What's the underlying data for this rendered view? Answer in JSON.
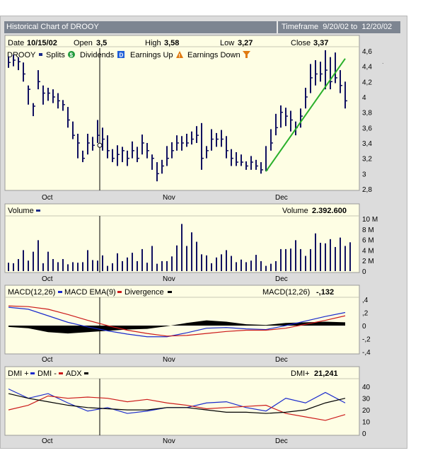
{
  "window": {
    "title": "Historical Chart of DROOY",
    "timeframe_label": "Timeframe",
    "timeframe_from": "9/20/02",
    "timeframe_to_word": "to",
    "timeframe_to": "12/20/02"
  },
  "price_panel": {
    "date_label": "Date",
    "date_value": "10/15/02",
    "open_label": "Open",
    "open_value": "3,5",
    "high_label": "High",
    "high_value": "3,58",
    "low_label": "Low",
    "low_value": "3,27",
    "close_label": "Close",
    "close_value": "3,37",
    "symbol": "DROOY",
    "legend": [
      {
        "label": "Splits",
        "icon": "square-marker-icon",
        "icon_char": "",
        "color": "#1a2a8a"
      },
      {
        "label": "Dividends",
        "icon": "dollar-icon",
        "icon_char": "$",
        "color": "#1f9a3a"
      },
      {
        "label": "Earnings Up",
        "icon": "d-box-icon",
        "icon_char": "D",
        "color": "#1f5fd8"
      },
      {
        "label": "Earnings Down",
        "icon": "warning-triangle-icon",
        "icon_char": "!",
        "color": "#e07a10"
      }
    ],
    "earnings_down_icon": "funnel-icon",
    "y_ticks": [
      "4,6",
      "4,4",
      "4,2",
      "4",
      "3,8",
      "3,6",
      "3,4",
      "3,2",
      "3",
      "2,8"
    ]
  },
  "volume_panel": {
    "title": "Volume",
    "value_label": "Volume",
    "value": "2.392.600",
    "y_ticks": [
      "10 M",
      "8 M",
      "6 M",
      "4 M",
      "2 M",
      "0"
    ]
  },
  "macd_panel": {
    "legend": [
      {
        "label": "MACD(12,26)",
        "color": "#1a2acc"
      },
      {
        "label": "MACD EMA(9)",
        "color": "#cc1a1a"
      },
      {
        "label": "Divergence",
        "color": "#000000"
      }
    ],
    "value_label": "MACD(12,26)",
    "value": "-,132",
    "y_ticks": [
      ",4",
      ",2",
      "0",
      "-,2",
      "-,4"
    ]
  },
  "dmi_panel": {
    "legend": [
      {
        "label": "DMI +",
        "color": "#1a2acc"
      },
      {
        "label": "DMI -",
        "color": "#cc1a1a"
      },
      {
        "label": "ADX",
        "color": "#000000"
      }
    ],
    "value_label": "DMI+",
    "value": "21,241",
    "y_ticks": [
      "40",
      "30",
      "20",
      "10",
      "0"
    ]
  },
  "x_ticks": [
    "Oct",
    "Nov",
    "Dec"
  ],
  "colors": {
    "panel_bg": "#fefee4",
    "bar": "#101060",
    "trendline": "#2ab02a",
    "frame": "#dcdcdc",
    "title_bg": "#7d8591"
  },
  "chart_data": [
    {
      "type": "ohlc",
      "title": "DROOY",
      "x_labels": [
        "Oct",
        "Nov",
        "Dec"
      ],
      "ylim": [
        2.8,
        4.6
      ],
      "high": [
        4.53,
        4.55,
        4.52,
        4.45,
        4.15,
        3.92,
        4.35,
        4.15,
        4.12,
        4.1,
        4.05,
        3.96,
        3.87,
        3.68,
        3.52,
        3.3,
        3.52,
        3.48,
        3.7,
        3.6,
        3.5,
        3.32,
        3.37,
        3.35,
        3.3,
        3.42,
        3.35,
        3.51,
        3.4,
        3.25,
        3.15,
        3.18,
        3.36,
        3.41,
        3.5,
        3.49,
        3.52,
        3.55,
        3.62,
        3.66,
        3.36,
        3.58,
        3.53,
        3.57,
        3.49,
        3.32,
        3.28,
        3.25,
        3.16,
        3.23,
        3.18,
        3.15,
        3.36,
        3.58,
        3.78,
        3.89,
        3.86,
        3.82,
        3.68,
        3.85,
        4.12,
        4.43,
        4.48,
        4.46,
        4.61,
        4.52,
        4.58,
        4.35,
        4.2
      ],
      "low": [
        4.38,
        4.4,
        4.35,
        4.2,
        3.9,
        3.75,
        4.1,
        3.9,
        3.95,
        3.92,
        3.85,
        3.82,
        3.6,
        3.45,
        3.2,
        3.15,
        3.25,
        3.3,
        3.4,
        3.3,
        3.2,
        3.15,
        3.1,
        3.15,
        3.1,
        3.2,
        3.15,
        3.25,
        3.2,
        3.05,
        2.9,
        3.0,
        3.1,
        3.2,
        3.3,
        3.3,
        3.35,
        3.38,
        3.4,
        3.05,
        3.2,
        3.3,
        3.35,
        3.35,
        3.2,
        3.1,
        3.1,
        3.1,
        3.05,
        3.05,
        3.05,
        3.0,
        3.03,
        3.3,
        3.5,
        3.6,
        3.62,
        3.55,
        3.5,
        3.6,
        3.85,
        4.05,
        4.15,
        4.2,
        4.1,
        4.1,
        4.18,
        4.05,
        3.85
      ],
      "close": [
        4.45,
        4.48,
        4.46,
        4.3,
        4.1,
        3.88,
        4.2,
        4.05,
        4.05,
        4.0,
        3.95,
        3.9,
        3.7,
        3.5,
        3.4,
        3.2,
        3.4,
        3.37,
        3.5,
        3.45,
        3.3,
        3.2,
        3.25,
        3.3,
        3.2,
        3.3,
        3.2,
        3.4,
        3.3,
        3.2,
        3.0,
        3.1,
        3.2,
        3.3,
        3.4,
        3.4,
        3.4,
        3.45,
        3.5,
        3.2,
        3.3,
        3.45,
        3.45,
        3.45,
        3.3,
        3.2,
        3.15,
        3.15,
        3.1,
        3.15,
        3.1,
        3.05,
        3.05,
        3.4,
        3.6,
        3.8,
        3.75,
        3.7,
        3.6,
        3.75,
        4.0,
        4.25,
        4.3,
        4.3,
        4.35,
        4.2,
        4.25,
        4.15,
        3.95
      ],
      "trendline": [
        [
          52,
          3.03
        ],
        [
          68,
          4.5
        ]
      ]
    },
    {
      "type": "bar",
      "title": "Volume",
      "unit": "M",
      "ylim": [
        0,
        10
      ],
      "values": [
        1.6,
        1.5,
        2.3,
        4.0,
        2.0,
        3.7,
        5.9,
        1.5,
        3.7,
        2.3,
        1.7,
        2.3,
        1.3,
        1.7,
        1.6,
        1.7,
        4.0,
        2.1,
        2.0,
        3.0,
        1.0,
        1.5,
        3.4,
        1.9,
        2.6,
        3.5,
        1.9,
        4.2,
        1.6,
        4.8,
        1.4,
        1.9,
        1.9,
        2.8,
        4.9,
        9.0,
        4.8,
        7.4,
        5.6,
        3.2,
        3.0,
        1.5,
        2.6,
        3.2,
        4.0,
        2.9,
        1.7,
        2.2,
        1.7,
        2.0,
        3.1,
        1.9,
        1.0,
        1.4,
        1.9,
        4.2,
        4.2,
        4.3,
        5.9,
        4.2,
        2.9,
        4.2,
        7.2,
        5.4,
        5.3,
        6.1,
        4.6,
        6.4,
        4.8,
        5.5
      ]
    },
    {
      "type": "line",
      "title": "MACD(12,26)",
      "ylim": [
        -0.4,
        0.4
      ],
      "x": [
        0,
        4,
        8,
        12,
        16,
        20,
        24,
        28,
        32,
        36,
        40,
        44,
        48,
        52,
        56,
        60,
        64,
        68
      ],
      "series": [
        {
          "name": "MACD(12,26)",
          "values": [
            0.28,
            0.25,
            0.15,
            0.05,
            -0.02,
            -0.08,
            -0.13,
            -0.17,
            -0.17,
            -0.11,
            -0.04,
            -0.03,
            -0.05,
            -0.06,
            0.0,
            0.07,
            0.14,
            0.2
          ]
        },
        {
          "name": "MACD EMA(9)",
          "values": [
            0.3,
            0.29,
            0.25,
            0.17,
            0.08,
            0.0,
            -0.07,
            -0.12,
            -0.16,
            -0.15,
            -0.12,
            -0.09,
            -0.07,
            -0.07,
            -0.04,
            0.02,
            0.08,
            0.15
          ]
        },
        {
          "name": "Divergence",
          "values": [
            -0.02,
            -0.04,
            -0.1,
            -0.12,
            -0.1,
            -0.08,
            -0.06,
            -0.05,
            -0.01,
            0.04,
            0.08,
            0.06,
            0.02,
            0.01,
            0.04,
            0.05,
            0.06,
            0.05
          ]
        }
      ]
    },
    {
      "type": "line",
      "title": "DMI",
      "ylim": [
        0,
        45
      ],
      "x": [
        0,
        4,
        8,
        12,
        16,
        20,
        24,
        28,
        32,
        36,
        40,
        44,
        48,
        52,
        56,
        60,
        64,
        68
      ],
      "series": [
        {
          "name": "DMI +",
          "values": [
            38,
            30,
            34,
            26,
            19,
            22,
            17,
            19,
            22,
            22,
            26,
            27,
            22,
            19,
            30,
            26,
            35,
            26
          ]
        },
        {
          "name": "DMI -",
          "values": [
            20,
            24,
            32,
            30,
            31,
            30,
            27,
            29,
            26,
            24,
            21,
            22,
            23,
            24,
            17,
            14,
            11,
            16
          ]
        },
        {
          "name": "ADX",
          "values": [
            34,
            30,
            27,
            24,
            22,
            21,
            20,
            20,
            22,
            22,
            20,
            18,
            18,
            17,
            18,
            20,
            26,
            30
          ]
        }
      ]
    }
  ]
}
